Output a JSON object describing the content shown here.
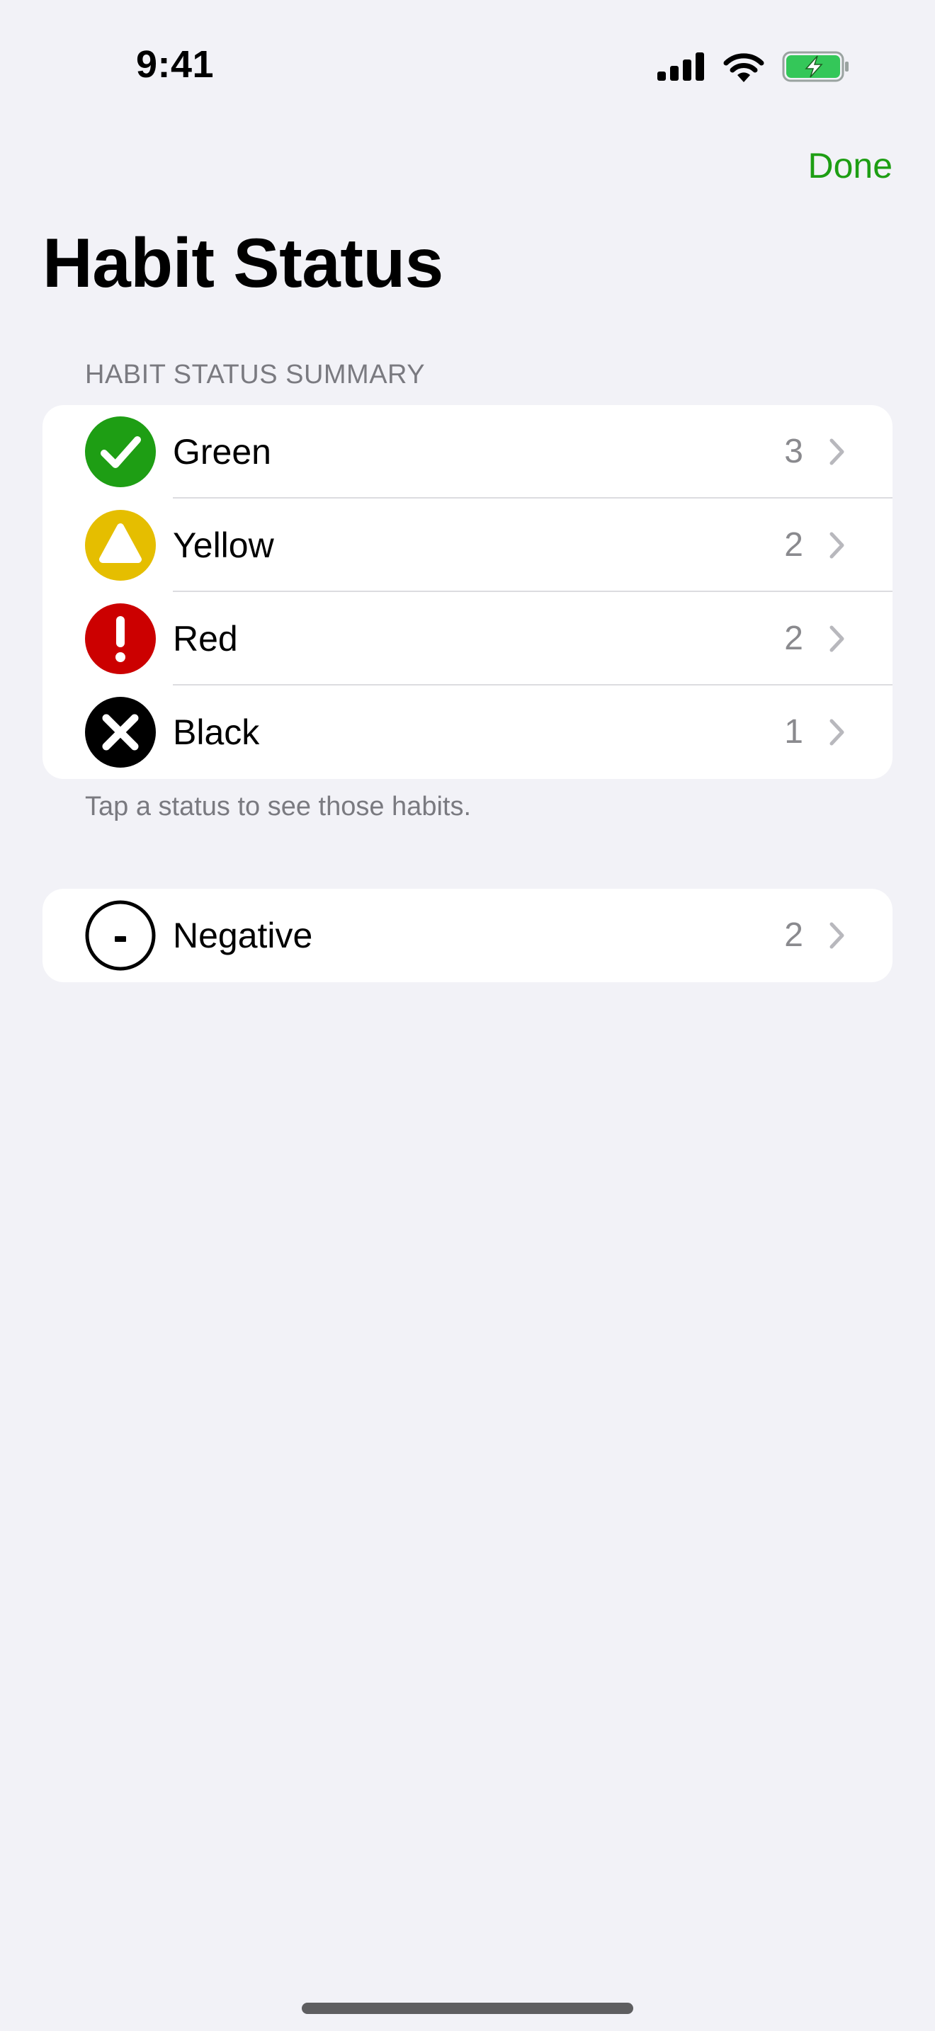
{
  "status_bar": {
    "time": "9:41"
  },
  "nav": {
    "done_label": "Done",
    "title": "Habit Status"
  },
  "summary": {
    "header": "HABIT STATUS SUMMARY",
    "footer": "Tap a status to see those habits.",
    "items": [
      {
        "label": "Green",
        "count": "3",
        "icon": "checkmark-circle-icon",
        "color": "#1E9E14"
      },
      {
        "label": "Yellow",
        "count": "2",
        "icon": "triangle-circle-icon",
        "color": "#E5BE00"
      },
      {
        "label": "Red",
        "count": "2",
        "icon": "exclamation-circle-icon",
        "color": "#CC0000"
      },
      {
        "label": "Black",
        "count": "1",
        "icon": "xmark-circle-icon",
        "color": "#000000"
      }
    ]
  },
  "negative": {
    "label": "Negative",
    "count": "2",
    "icon": "minus-circle-outline-icon"
  },
  "colors": {
    "accent": "#1E9E14",
    "background": "#F2F2F7",
    "card": "#FFFFFF",
    "secondary_text": "#8A8A8E"
  }
}
